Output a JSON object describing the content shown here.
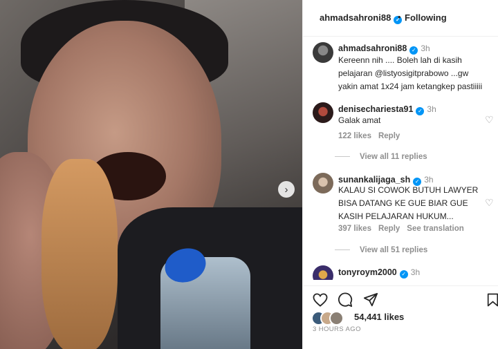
{
  "post": {
    "username": "ahmadsahroni88",
    "separator": "•",
    "follow_status": "Following"
  },
  "comments": [
    {
      "username": "ahmadsahroni88",
      "time": "3h",
      "lines": [
        "Kereenn nih .... Boleh lah di kasih",
        "pelajaran @listyosigitprabowo ...gw",
        "yakin amat 1x24 jam ketangkep pastiiiii"
      ]
    },
    {
      "username": "denisechariesta91",
      "time": "3h",
      "lines": [
        "Galak amat"
      ],
      "likes": "122 likes",
      "reply": "Reply",
      "view_replies": "View all 11 replies"
    },
    {
      "username": "sunankalijaga_sh",
      "time": "3h",
      "lines": [
        "KALAU SI COWOK BUTUH LAWYER",
        "BISA DATANG KE GUE BIAR GUE",
        "KASIH PELAJARAN HUKUM..."
      ],
      "likes": "397 likes",
      "reply": "Reply",
      "translate": "See translation",
      "view_replies": "View all 51 replies"
    },
    {
      "username": "tonyroym2000",
      "time": "3h"
    }
  ],
  "likes_count": "54,441 likes",
  "posted_ago": "3 HOURS AGO",
  "icons": {
    "next": "chevron-right-icon",
    "like": "heart-icon",
    "comment": "comment-icon",
    "share": "send-icon",
    "save": "bookmark-icon",
    "verified": "verified-badge-icon"
  },
  "colors": {
    "verified": "#0095f6",
    "muted": "#8e8e8e",
    "text": "#262626"
  }
}
